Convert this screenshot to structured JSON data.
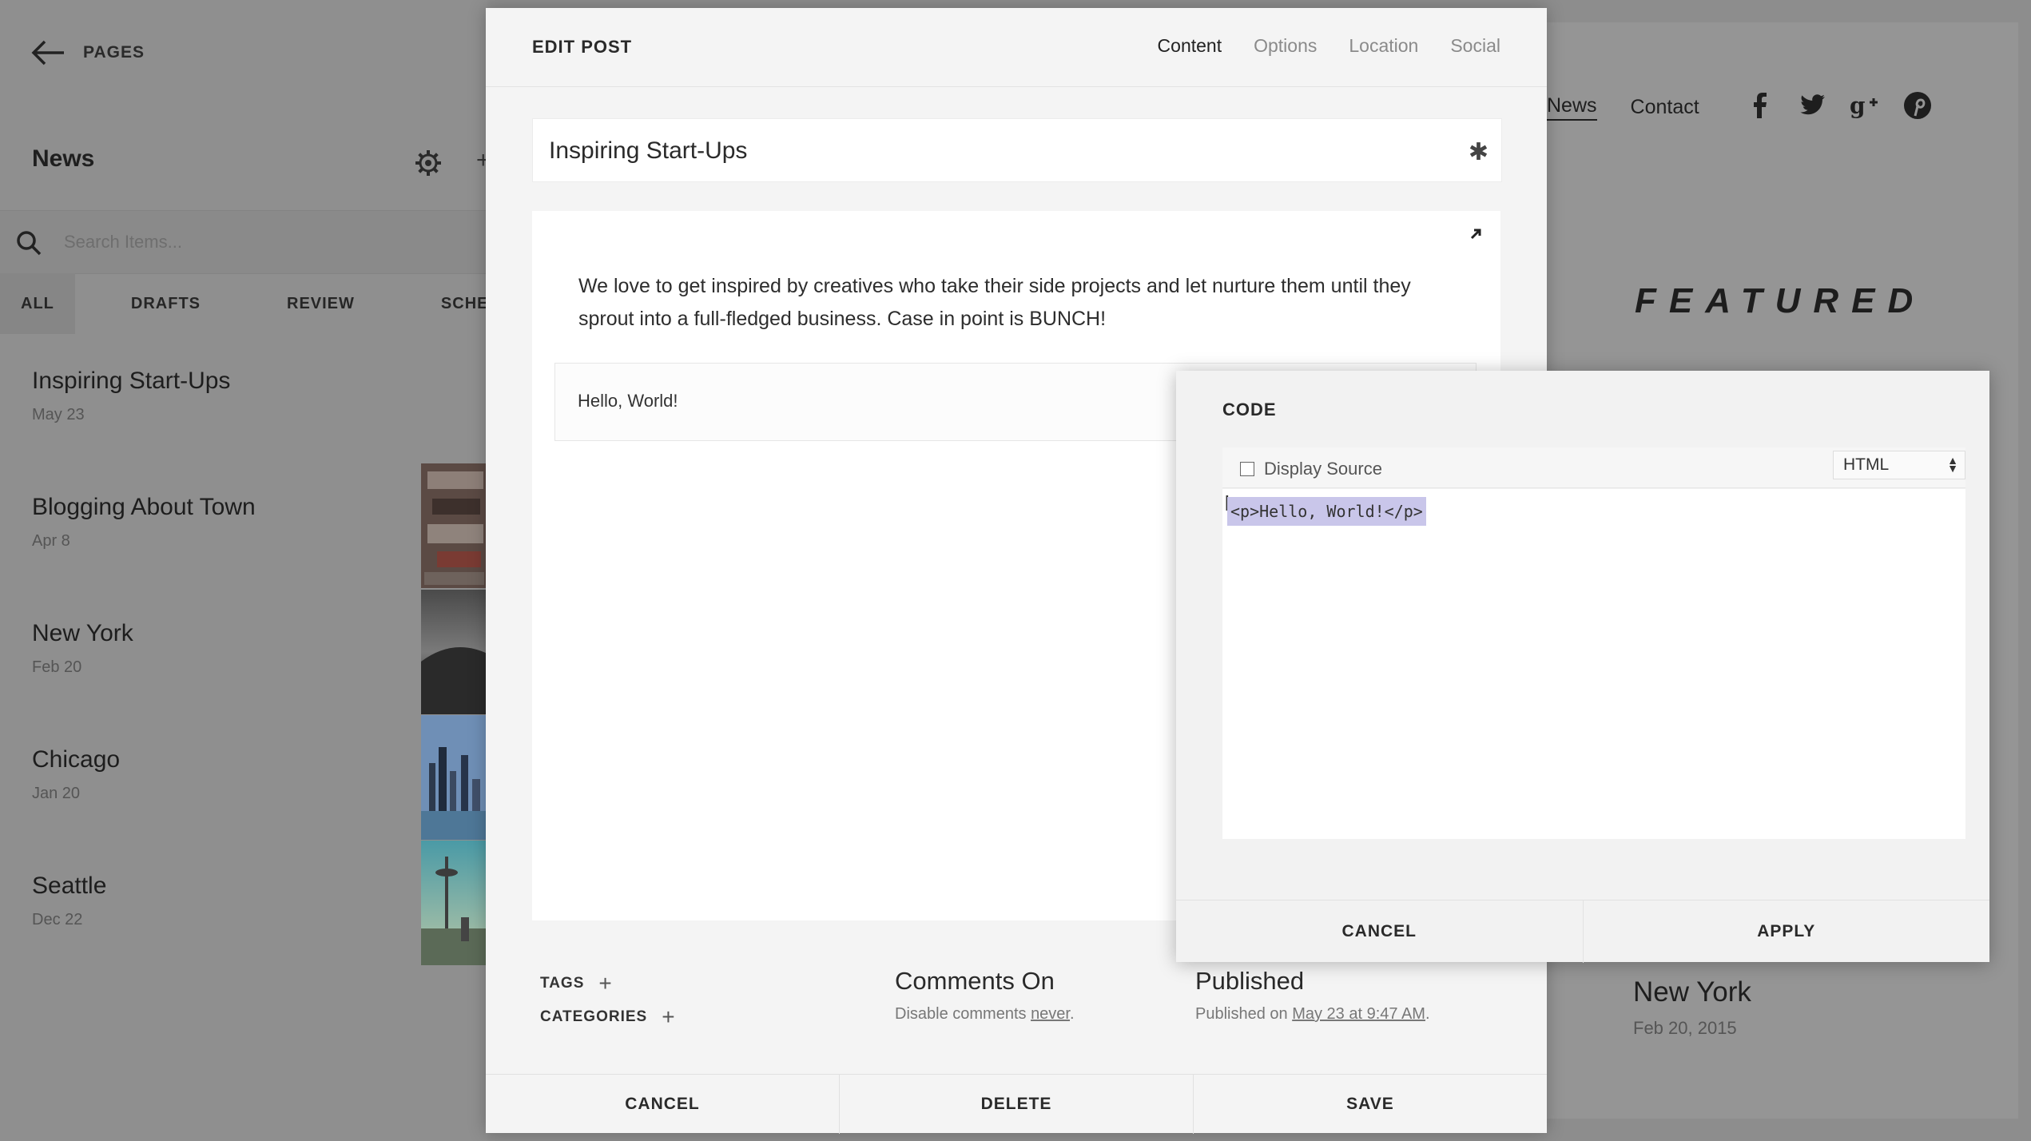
{
  "left_panel": {
    "back_label": "PAGES",
    "collection_title": "News",
    "search_placeholder": "Search Items...",
    "filters": [
      "ALL",
      "DRAFTS",
      "REVIEW",
      "SCHEDUL"
    ],
    "posts": [
      {
        "title": "Inspiring Start-Ups",
        "date": "May 23"
      },
      {
        "title": "Blogging About Town",
        "date": "Apr 8"
      },
      {
        "title": "New York",
        "date": "Feb 20"
      },
      {
        "title": "Chicago",
        "date": "Jan 20"
      },
      {
        "title": "Seattle",
        "date": "Dec 22"
      }
    ]
  },
  "site": {
    "nav": [
      "News",
      "Contact"
    ],
    "social": [
      "facebook-icon",
      "twitter-icon",
      "google-plus-icon",
      "pinterest-icon"
    ],
    "featured": "FEATURED",
    "post": {
      "title": "New York",
      "date": "Feb 20, 2015"
    }
  },
  "modal": {
    "title": "EDIT POST",
    "tabs": [
      "Content",
      "Options",
      "Location",
      "Social"
    ],
    "active_tab": "Content",
    "post_title": "Inspiring Start-Ups",
    "body": "We love to get inspired by creatives who take their side projects and let nurture them until they sprout into a full-fledged business. Case in point is BUNCH!",
    "code_preview": "Hello, World!",
    "tags_label": "TAGS",
    "categories_label": "CATEGORIES",
    "comments": {
      "heading": "Comments On",
      "prefix": "Disable comments ",
      "link": "never",
      "suffix": "."
    },
    "published": {
      "heading": "Published",
      "prefix": "Published on ",
      "link": "May 23 at 9:47 AM",
      "suffix": "."
    },
    "footer": {
      "cancel": "CANCEL",
      "delete": "DELETE",
      "save": "SAVE"
    }
  },
  "code_dialog": {
    "title": "CODE",
    "display_source_label": "Display Source",
    "mode": "HTML",
    "code": "<p>Hello, World!</p>",
    "cancel": "CANCEL",
    "apply": "APPLY"
  }
}
